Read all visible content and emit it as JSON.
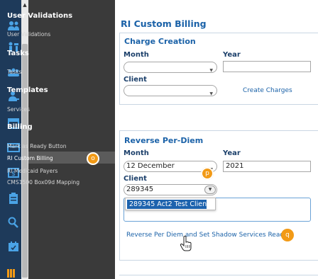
{
  "menu": {
    "sections": [
      {
        "heading": "User Validations",
        "items": [
          "User Validations"
        ]
      },
      {
        "heading": "Tasks",
        "items": [
          "Tasks"
        ]
      },
      {
        "heading": "Templates",
        "items": [
          "Services"
        ]
      },
      {
        "heading": "Billing",
        "items": [
          "Mark as Ready Button",
          "RI Custom Billing",
          "RI Medicaid Payers",
          "CMS1500 Box09d Mapping"
        ]
      }
    ],
    "active_item": "RI Custom Billing",
    "active_badge": "o"
  },
  "page": {
    "title": "RI Custom Billing"
  },
  "charge_creation": {
    "title": "Charge Creation",
    "month_label": "Month",
    "month_value": "",
    "year_label": "Year",
    "year_value": "",
    "client_label": "Client",
    "client_value": "",
    "action_link": "Create Charges"
  },
  "reverse_per_diem": {
    "title": "Reverse Per-Diem",
    "month_label": "Month",
    "month_value": "12 December",
    "year_label": "Year",
    "year_value": "2021",
    "client_label": "Client",
    "client_value": "289345",
    "suggestion": "289345 Act2 Test Client",
    "client_badge": "p",
    "action_link": "Reverse Per Diem and Set Shadow Services Ready",
    "action_badge": "q"
  },
  "icons": [
    "users-icon",
    "person-hierarchy-icon",
    "group-icon",
    "person-icon",
    "calendar-icon",
    "card-icon",
    "dollar-icon",
    "clipboard-icon",
    "search-icon",
    "calendar-check-icon",
    "menu-bars-icon"
  ],
  "colors": {
    "accent": "#1b62a8",
    "sidebar": "#3a3a3a",
    "rail": "#1e3a5a",
    "badge": "#f29a16",
    "selection": "#1d63ae"
  }
}
